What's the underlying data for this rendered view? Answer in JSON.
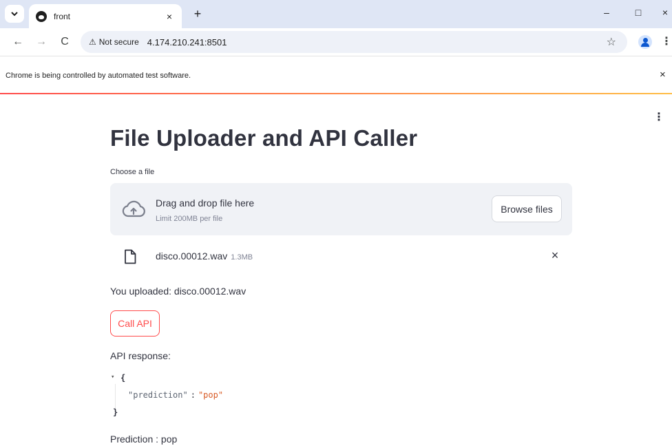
{
  "browser": {
    "tab": {
      "title": "front",
      "close_glyph": "×"
    },
    "new_tab_glyph": "+",
    "window": {
      "minimize": "–",
      "maximize": "□",
      "close": "×"
    },
    "nav": {
      "back": "←",
      "forward": "→",
      "reload": "C"
    },
    "omnibox": {
      "warning_glyph": "⚠",
      "security": "Not secure",
      "url": "4.174.210.241:8501",
      "star": "☆"
    },
    "menu_glyph": "⋮",
    "infobar": {
      "message": "Chrome is being controlled by automated test software.",
      "close_glyph": "×"
    }
  },
  "app": {
    "menu_glyph": "⋮",
    "title": "File Uploader and API Caller",
    "uploader": {
      "label": "Choose a file",
      "drop_title": "Drag and drop file here",
      "limit": "Limit 200MB per file",
      "browse_label": "Browse files"
    },
    "file": {
      "name": "disco.00012.wav",
      "size": "1.3MB",
      "remove_glyph": "×"
    },
    "uploaded_text": "You uploaded: disco.00012.wav",
    "call_api_label": "Call API",
    "api_response_label": "API response:",
    "json": {
      "toggle_glyph": "▾",
      "open": "{",
      "key": "\"prediction\"",
      "colon": ":",
      "value": "\"pop\"",
      "close": "}"
    },
    "prediction_text": "Prediction : pop"
  },
  "colors": {
    "accent": "#ff4b4b",
    "text": "#31333f",
    "dropzone_bg": "#f0f2f6",
    "tabbar_bg": "#dfe6f5",
    "json_value": "#d85a24"
  }
}
